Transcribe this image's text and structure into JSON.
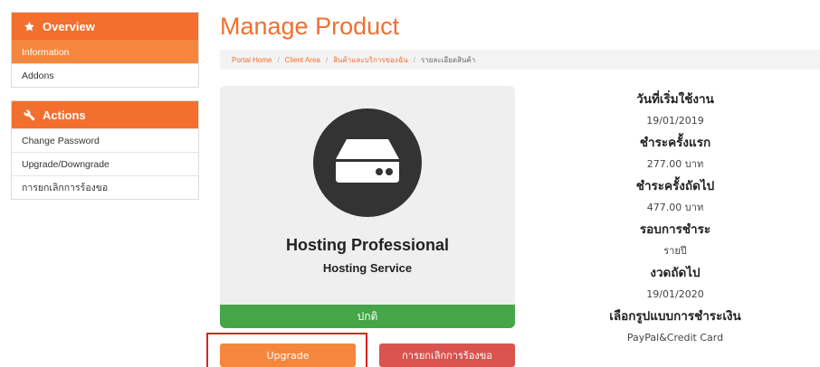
{
  "sidebar": {
    "overview": {
      "title": "Overview",
      "icon": "star-icon",
      "items": [
        {
          "label": "Information",
          "active": true
        },
        {
          "label": "Addons",
          "active": false
        }
      ]
    },
    "actions": {
      "title": "Actions",
      "icon": "wrench-icon",
      "items": [
        {
          "label": "Change Password"
        },
        {
          "label": "Upgrade/Downgrade"
        },
        {
          "label": "การยกเลิกการร้องขอ"
        }
      ]
    }
  },
  "main": {
    "title": "Manage Product",
    "breadcrumb": [
      {
        "label": "Portal Home"
      },
      {
        "label": "Client Area"
      },
      {
        "label": "สินค้าและบริการของฉัน"
      },
      {
        "label": "รายละเอียดสินค้า"
      }
    ],
    "product": {
      "icon": "server-icon",
      "name": "Hosting Professional",
      "group": "Hosting Service",
      "status": "ปกติ",
      "status_color": "#44a646"
    },
    "buttons": {
      "upgrade": "Upgrade",
      "cancel": "การยกเลิกการร้องขอ"
    },
    "details": [
      {
        "label": "วันที่เริ่มใช้งาน",
        "value": "19/01/2019"
      },
      {
        "label": "ชำระครั้งแรก",
        "value": "277.00 บาท"
      },
      {
        "label": "ชำระครั้งถัดไป",
        "value": "477.00 บาท"
      },
      {
        "label": "รอบการชำระ",
        "value": "รายปี"
      },
      {
        "label": "งวดถัดไป",
        "value": "19/01/2020"
      },
      {
        "label": "เลือกรูปแบบการชำระเงิน",
        "value": "PayPal&Credit Card"
      }
    ]
  },
  "colors": {
    "accent": "#f26f2e",
    "cancel": "#d9534f",
    "highlight": "#dd2222"
  }
}
